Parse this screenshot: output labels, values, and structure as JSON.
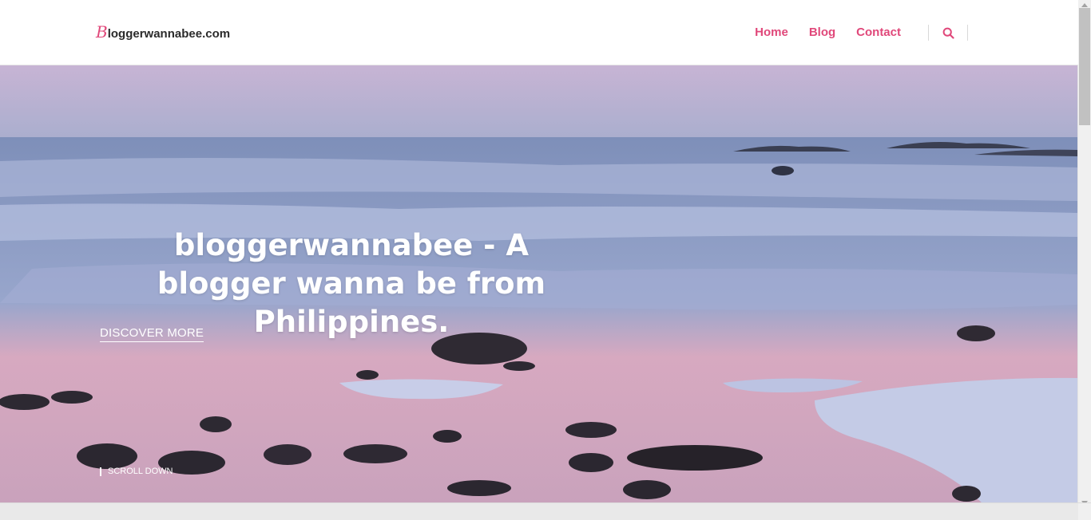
{
  "header": {
    "logo_mark": "B",
    "logo_text": "loggerwannabee.com",
    "nav": [
      {
        "label": "Home"
      },
      {
        "label": "Blog"
      },
      {
        "label": "Contact"
      }
    ],
    "search_icon": "search-icon"
  },
  "hero": {
    "title": "bloggerwannabee - A blogger wanna be from Philippines.",
    "cta_label": "DISCOVER MORE",
    "scroll_label": "SCROLL DOWN"
  },
  "colors": {
    "accent": "#e0487a",
    "header_bg": "#ffffff",
    "hero_text": "#ffffff"
  }
}
